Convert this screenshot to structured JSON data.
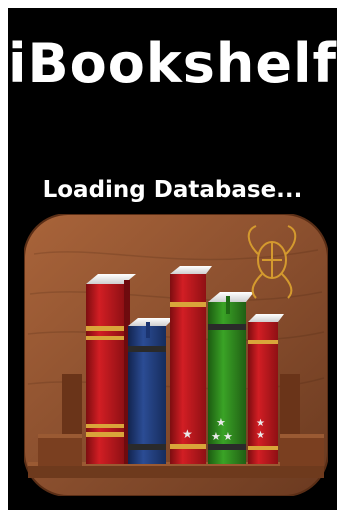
{
  "app": {
    "title": "iBookshelf",
    "status_text": "Loading Database..."
  },
  "icons": {
    "app_icon": "bookshelf-app-icon",
    "emblem": "ornate-emblem-icon"
  },
  "colors": {
    "background": "#000000",
    "frame": "#ffffff",
    "text": "#ffffff",
    "wood": "#8a4f2e",
    "book_red": "#c0171c",
    "book_blue": "#1f3a78",
    "book_green": "#2f8a1e",
    "band_gold": "#d9a53a",
    "emblem_gold": "#d49a2e"
  }
}
